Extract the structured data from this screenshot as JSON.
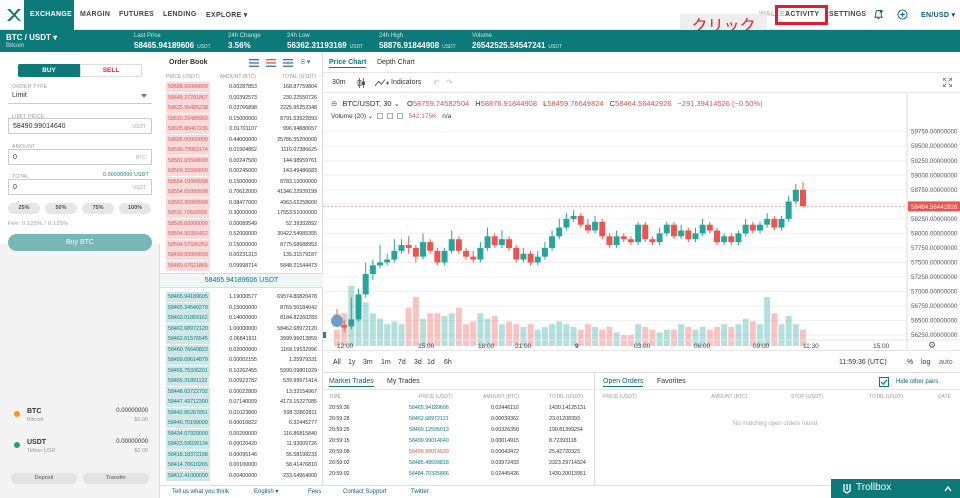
{
  "nav": {
    "items": [
      {
        "label": "EXCHANGE",
        "x": 30,
        "active": true
      },
      {
        "label": "MARGIN",
        "x": 80
      },
      {
        "label": "FUTURES",
        "x": 119
      },
      {
        "label": "LENDING",
        "x": 163
      },
      {
        "label": "EXPLORE ▾",
        "x": 206
      }
    ],
    "right": {
      "activity": "ACTIVITY",
      "settings": "SETTINGS",
      "locale": "EN/USD ▾",
      "wallet_ghost": "WALLET"
    },
    "annotation": "クリック"
  },
  "ticker": {
    "pair": "BTC / USDT ▾",
    "pair_name": "Bitcoin",
    "stats": [
      {
        "label": "Last Price",
        "value": "58465.94189606",
        "unit": "USDT"
      },
      {
        "label": "24h Change",
        "value": "3.56%",
        "unit": ""
      },
      {
        "label": "24h Low",
        "value": "56362.31193169",
        "unit": "USDT"
      },
      {
        "label": "24h High",
        "value": "58876.91844908",
        "unit": "USDT"
      },
      {
        "label": "Volume",
        "value": "26542525.54547241",
        "unit": "USDT"
      }
    ]
  },
  "trade": {
    "buy": "BUY",
    "sell": "SELL",
    "order_type_label": "ORDER TYPE",
    "order_type": "Limit",
    "limit_price_label": "LIMIT PRICE",
    "limit_price": "58490.99014640",
    "limit_unit": "USDT",
    "amount_label": "AMOUNT",
    "amount": "0",
    "amount_unit": "BTC",
    "total_label": "TOTAL",
    "total_avail": "0.00000000 USDT",
    "total": "0",
    "total_unit": "USDT",
    "pcts": [
      "25%",
      "50%",
      "75%",
      "100%"
    ],
    "fee": "Fee: 0.125% / 0.125%",
    "submit": "Buy BTC"
  },
  "wallets": [
    {
      "cur": "BTC",
      "name": "Bitcoin",
      "amt": "0.00000000",
      "usd": "$0.00",
      "color": "#f29a1f"
    },
    {
      "cur": "USDT",
      "name": "Tether USD",
      "amt": "0.00000000",
      "usd": "$0.00",
      "color": "#26a17b"
    }
  ],
  "wallet_buttons": {
    "deposit": "Deposit",
    "transfer": "Transfer"
  },
  "orderbook": {
    "title": "Order Book",
    "depth": "8 ▾",
    "headers": [
      "PRICE (USDT)",
      "AMOUNT (BTC)",
      "TOTAL (USDT)"
    ],
    "asks": [
      [
        "58688.00000000",
        "0.00287853",
        "168.87759804"
      ],
      [
        "58645.27291867",
        "0.00392573",
        "230.22550726"
      ],
      [
        "58625.55485238",
        "0.03766898",
        "2225.95252348"
      ],
      [
        "58610.23485950",
        "0.15000000",
        "8791.53522893"
      ],
      [
        "58605.88467236",
        "0.01701107",
        "996.94880657"
      ],
      [
        "58605.00000000",
        "0.44000000",
        "25786.55200000"
      ],
      [
        "58590.79983174",
        "0.01904862",
        "1116.07386625"
      ],
      [
        "58581.65568000",
        "0.00247500",
        "144.98959761"
      ],
      [
        "58569.33340000",
        "0.00245000",
        "143.49486683"
      ],
      [
        "58554.19999998",
        "0.15000000",
        "8783.13000000"
      ],
      [
        "58554.09999998",
        "0.70612000",
        "41346.22939199"
      ],
      [
        "58553.99999998",
        "0.08477000",
        "4963.62258000"
      ],
      [
        "58511.70600000",
        "0.30000000",
        "17553.51000000"
      ],
      [
        "58508.00000000",
        "0.00089549",
        "52.39332892"
      ],
      [
        "58504.90356452",
        "0.52000000",
        "30422.54985355"
      ],
      [
        "58504.57926352",
        "0.15000000",
        "8775.68688953"
      ],
      [
        "58499.00000000",
        "0.00231313",
        "135.31579187"
      ],
      [
        "58489.67621865",
        "0.09998714",
        "5848.21544473"
      ]
    ],
    "mid": "58465.94189606 USDT",
    "bids": [
      [
        "58465.94189605",
        "1.19000577",
        "69574.80820478"
      ],
      [
        "58465.34540279",
        "0.15000000",
        "8769.50184042"
      ],
      [
        "58463.01859162",
        "0.14000000",
        "8184.82260283"
      ],
      [
        "58462.68972120",
        "1.00000000",
        "58462.68972120"
      ],
      [
        "58462.61576545",
        "0.06841911",
        "3999.96013859"
      ],
      [
        "58460.76649823",
        "0.02000000",
        "1169.19532996"
      ],
      [
        "58459.09614879",
        "0.00002155",
        "1.25979331"
      ],
      [
        "58456.75336201",
        "0.10262455",
        "5999.09801029"
      ],
      [
        "58455.31891122",
        "0.00923782",
        "539.99971414"
      ],
      [
        "58448.63722792",
        "0.00022809",
        "13.33154967"
      ],
      [
        "58447.43712300",
        "0.07140009",
        "4173.15227085"
      ],
      [
        "58442.86267851",
        "0.01023800",
        "598.33802811"
      ],
      [
        "58440.70199000",
        "0.00010822",
        "6.32445277"
      ],
      [
        "58434.07920000",
        "0.00200000",
        "116.86815840"
      ],
      [
        "58423.59930134",
        "0.00020420",
        "11.93009726"
      ],
      [
        "58418.18372198",
        "0.00095146",
        "55.58198233"
      ],
      [
        "58414.70610265",
        "0.00100000",
        "58.41476810"
      ],
      [
        "58412.41000000",
        "0.00400000",
        "233.64964000"
      ]
    ]
  },
  "chart": {
    "tabs": [
      "Price Chart",
      "Depth Chart"
    ],
    "interval": "30m",
    "indicators": "Indicators",
    "legend": "BTC/USDT, 30",
    "ohlc": {
      "o": "58759.74582504",
      "h": "58876.91844908",
      "l": "58459.76649824",
      "c": "58464.56442926",
      "chg": "−291.39414526 (−0.50%)"
    },
    "volume_label": "Volume (20)",
    "volume_val": "542.175K",
    "volume_na": "n/a",
    "current_price": "58464.56442926",
    "x_ticks": [
      "12:00",
      "15:00",
      "18:00",
      "21:00",
      "9",
      "03:00",
      "06:00",
      "09:00",
      "11:30",
      "15:00"
    ],
    "ranges": [
      "All",
      "1y",
      "3m",
      "1m",
      "7d",
      "3d",
      "1d",
      "6h"
    ],
    "clock": "11:59:36 (UTC)",
    "pct": "%",
    "log": "log",
    "auto": "auto"
  },
  "chart_data": {
    "type": "candlestick",
    "title": "BTC/USDT, 30",
    "ylim": [
      56200,
      59900
    ],
    "y_ticks": [
      59750,
      59500,
      59250,
      59000,
      58750,
      58500,
      58250,
      58000,
      57750,
      57500,
      57250,
      57000,
      56750,
      56500,
      56250
    ],
    "candles": [
      {
        "o": 56600,
        "c": 56450,
        "h": 56700,
        "l": 56400,
        "v": 30
      },
      {
        "o": 56420,
        "c": 56380,
        "h": 56500,
        "l": 56300,
        "v": 60
      },
      {
        "o": 56400,
        "c": 56520,
        "h": 56900,
        "l": 56350,
        "v": 110
      },
      {
        "o": 56520,
        "c": 56950,
        "h": 57050,
        "l": 56480,
        "v": 90
      },
      {
        "o": 56950,
        "c": 57300,
        "h": 57500,
        "l": 56900,
        "v": 80
      },
      {
        "o": 57300,
        "c": 57450,
        "h": 57550,
        "l": 57200,
        "v": 60
      },
      {
        "o": 57450,
        "c": 57500,
        "h": 57800,
        "l": 57400,
        "v": 50
      },
      {
        "o": 57500,
        "c": 57550,
        "h": 57650,
        "l": 57450,
        "v": 40
      },
      {
        "o": 57550,
        "c": 57700,
        "h": 57900,
        "l": 57500,
        "v": 45
      },
      {
        "o": 57700,
        "c": 57800,
        "h": 57900,
        "l": 57650,
        "v": 40
      },
      {
        "o": 57800,
        "c": 57750,
        "h": 57950,
        "l": 57650,
        "v": 70
      },
      {
        "o": 57750,
        "c": 57600,
        "h": 57800,
        "l": 57500,
        "v": 90
      },
      {
        "o": 57600,
        "c": 57850,
        "h": 58000,
        "l": 57550,
        "v": 50
      },
      {
        "o": 57850,
        "c": 57700,
        "h": 57900,
        "l": 57650,
        "v": 60
      },
      {
        "o": 57700,
        "c": 57500,
        "h": 57750,
        "l": 57450,
        "v": 60
      },
      {
        "o": 57500,
        "c": 57700,
        "h": 57750,
        "l": 57450,
        "v": 55
      },
      {
        "o": 57700,
        "c": 57900,
        "h": 58050,
        "l": 57650,
        "v": 60
      },
      {
        "o": 57900,
        "c": 57700,
        "h": 57950,
        "l": 57650,
        "v": 70
      },
      {
        "o": 57700,
        "c": 57600,
        "h": 57750,
        "l": 57550,
        "v": 40
      },
      {
        "o": 57600,
        "c": 57550,
        "h": 57700,
        "l": 57500,
        "v": 45
      },
      {
        "o": 57550,
        "c": 57750,
        "h": 57850,
        "l": 57500,
        "v": 60
      },
      {
        "o": 57750,
        "c": 57950,
        "h": 58100,
        "l": 57700,
        "v": 50
      },
      {
        "o": 57950,
        "c": 57800,
        "h": 58000,
        "l": 57750,
        "v": 55
      },
      {
        "o": 57800,
        "c": 57900,
        "h": 58050,
        "l": 57750,
        "v": 40
      },
      {
        "o": 57900,
        "c": 57750,
        "h": 57950,
        "l": 57700,
        "v": 45
      },
      {
        "o": 57750,
        "c": 57550,
        "h": 57800,
        "l": 57500,
        "v": 40
      },
      {
        "o": 57550,
        "c": 57650,
        "h": 57750,
        "l": 57500,
        "v": 35
      },
      {
        "o": 57650,
        "c": 57500,
        "h": 57700,
        "l": 57450,
        "v": 40
      },
      {
        "o": 57500,
        "c": 57600,
        "h": 57700,
        "l": 57450,
        "v": 30
      },
      {
        "o": 57600,
        "c": 57750,
        "h": 57850,
        "l": 57550,
        "v": 35
      },
      {
        "o": 57750,
        "c": 57950,
        "h": 58050,
        "l": 57700,
        "v": 40
      },
      {
        "o": 57950,
        "c": 58100,
        "h": 58250,
        "l": 57900,
        "v": 45
      },
      {
        "o": 58100,
        "c": 58250,
        "h": 58350,
        "l": 58050,
        "v": 40
      },
      {
        "o": 58250,
        "c": 58300,
        "h": 58400,
        "l": 58200,
        "v": 35
      },
      {
        "o": 58300,
        "c": 58150,
        "h": 58350,
        "l": 58100,
        "v": 30
      },
      {
        "o": 58150,
        "c": 58050,
        "h": 58250,
        "l": 58000,
        "v": 40
      },
      {
        "o": 58050,
        "c": 58200,
        "h": 58300,
        "l": 58000,
        "v": 35
      },
      {
        "o": 58200,
        "c": 57950,
        "h": 58250,
        "l": 57900,
        "v": 30
      },
      {
        "o": 57950,
        "c": 57800,
        "h": 58000,
        "l": 57750,
        "v": 35
      },
      {
        "o": 57800,
        "c": 57950,
        "h": 58050,
        "l": 57750,
        "v": 25
      },
      {
        "o": 57950,
        "c": 57900,
        "h": 58000,
        "l": 57850,
        "v": 20
      },
      {
        "o": 57900,
        "c": 57850,
        "h": 57950,
        "l": 57800,
        "v": 20
      },
      {
        "o": 57850,
        "c": 58150,
        "h": 58200,
        "l": 57800,
        "v": 40
      },
      {
        "o": 58150,
        "c": 57900,
        "h": 58200,
        "l": 57850,
        "v": 35
      },
      {
        "o": 57900,
        "c": 57850,
        "h": 57950,
        "l": 57800,
        "v": 30
      },
      {
        "o": 57850,
        "c": 58000,
        "h": 58100,
        "l": 57800,
        "v": 25
      },
      {
        "o": 58000,
        "c": 58150,
        "h": 58200,
        "l": 57950,
        "v": 30
      },
      {
        "o": 58150,
        "c": 57950,
        "h": 58200,
        "l": 57900,
        "v": 30
      },
      {
        "o": 57950,
        "c": 58050,
        "h": 58150,
        "l": 57900,
        "v": 40
      },
      {
        "o": 58050,
        "c": 57900,
        "h": 58100,
        "l": 57850,
        "v": 35
      },
      {
        "o": 57900,
        "c": 58000,
        "h": 58100,
        "l": 57850,
        "v": 30
      },
      {
        "o": 58000,
        "c": 58150,
        "h": 58250,
        "l": 57950,
        "v": 35
      },
      {
        "o": 58150,
        "c": 58050,
        "h": 58200,
        "l": 58000,
        "v": 30
      },
      {
        "o": 58050,
        "c": 57850,
        "h": 58100,
        "l": 57800,
        "v": 35
      },
      {
        "o": 57850,
        "c": 57950,
        "h": 58000,
        "l": 57800,
        "v": 40
      },
      {
        "o": 57950,
        "c": 57850,
        "h": 58000,
        "l": 57800,
        "v": 35
      },
      {
        "o": 57850,
        "c": 58000,
        "h": 58050,
        "l": 57800,
        "v": 40
      },
      {
        "o": 58000,
        "c": 58150,
        "h": 58250,
        "l": 57950,
        "v": 50
      },
      {
        "o": 58150,
        "c": 58050,
        "h": 58200,
        "l": 58000,
        "v": 45
      },
      {
        "o": 58050,
        "c": 58150,
        "h": 58200,
        "l": 58000,
        "v": 40
      },
      {
        "o": 58150,
        "c": 58250,
        "h": 58350,
        "l": 58100,
        "v": 90
      },
      {
        "o": 58250,
        "c": 58100,
        "h": 58300,
        "l": 58050,
        "v": 60
      },
      {
        "o": 58100,
        "c": 58250,
        "h": 58300,
        "l": 58050,
        "v": 40
      },
      {
        "o": 58250,
        "c": 58550,
        "h": 58650,
        "l": 58200,
        "v": 55
      },
      {
        "o": 58550,
        "c": 58750,
        "h": 58850,
        "l": 58500,
        "v": 40
      },
      {
        "o": 58750,
        "c": 58470,
        "h": 58880,
        "l": 58460,
        "v": 30
      }
    ],
    "current_price": 58464.56442926
  },
  "trades": {
    "tabs": [
      "Market Trades",
      "My Trades"
    ],
    "headers": [
      "TIME",
      "PRICE (USDT)",
      "AMOUNT (BTC)",
      "TOTAL (USDT)"
    ],
    "rows": [
      {
        "t": "20:59:36",
        "p": "58465.94189606",
        "a": "0.02446110",
        "tot": "1430.14125131",
        "side": "buy"
      },
      {
        "t": "20:59:28",
        "p": "58462.68972121",
        "a": "0.00039362",
        "tot": "23.01208393",
        "side": "buy"
      },
      {
        "t": "20:59:25",
        "p": "58469.12595013",
        "a": "0.00326350",
        "tot": "190.81399254",
        "side": "buy"
      },
      {
        "t": "20:59:15",
        "p": "58490.99014640",
        "a": "0.00014915",
        "tot": "8.72393118",
        "side": "buy"
      },
      {
        "t": "20:59:08",
        "p": "58490.99014639",
        "a": "0.00043472",
        "tot": "25.42720323",
        "side": "sell"
      },
      {
        "t": "20:59:02",
        "p": "58485.49599818",
        "a": "0.03972433",
        "tot": "2323.29714324",
        "side": "buy"
      },
      {
        "t": "20:59:02",
        "p": "58484.70325866",
        "a": "0.02445426",
        "tot": "1430.20013951",
        "side": "buy"
      }
    ]
  },
  "orders": {
    "tabs": [
      "Open Orders",
      "Favorites"
    ],
    "hide": "Hide other pairs",
    "headers": [
      "PRICE (USDT)",
      "AMOUNT (BTC)",
      "STOP (USDT)",
      "TOTAL (USDT)",
      "DATE"
    ],
    "empty": "No matching open orders found"
  },
  "footer": {
    "links": [
      "Tell us what you think",
      "English ▾",
      "Fees",
      "Contact Support",
      "Twitter"
    ],
    "trollbox": "Trollbox"
  },
  "colors": {
    "brand": "#0c7a78",
    "up": "#26a69a",
    "down": "#ef5350",
    "ask": "#d9534f",
    "annot": "#e8192c"
  }
}
